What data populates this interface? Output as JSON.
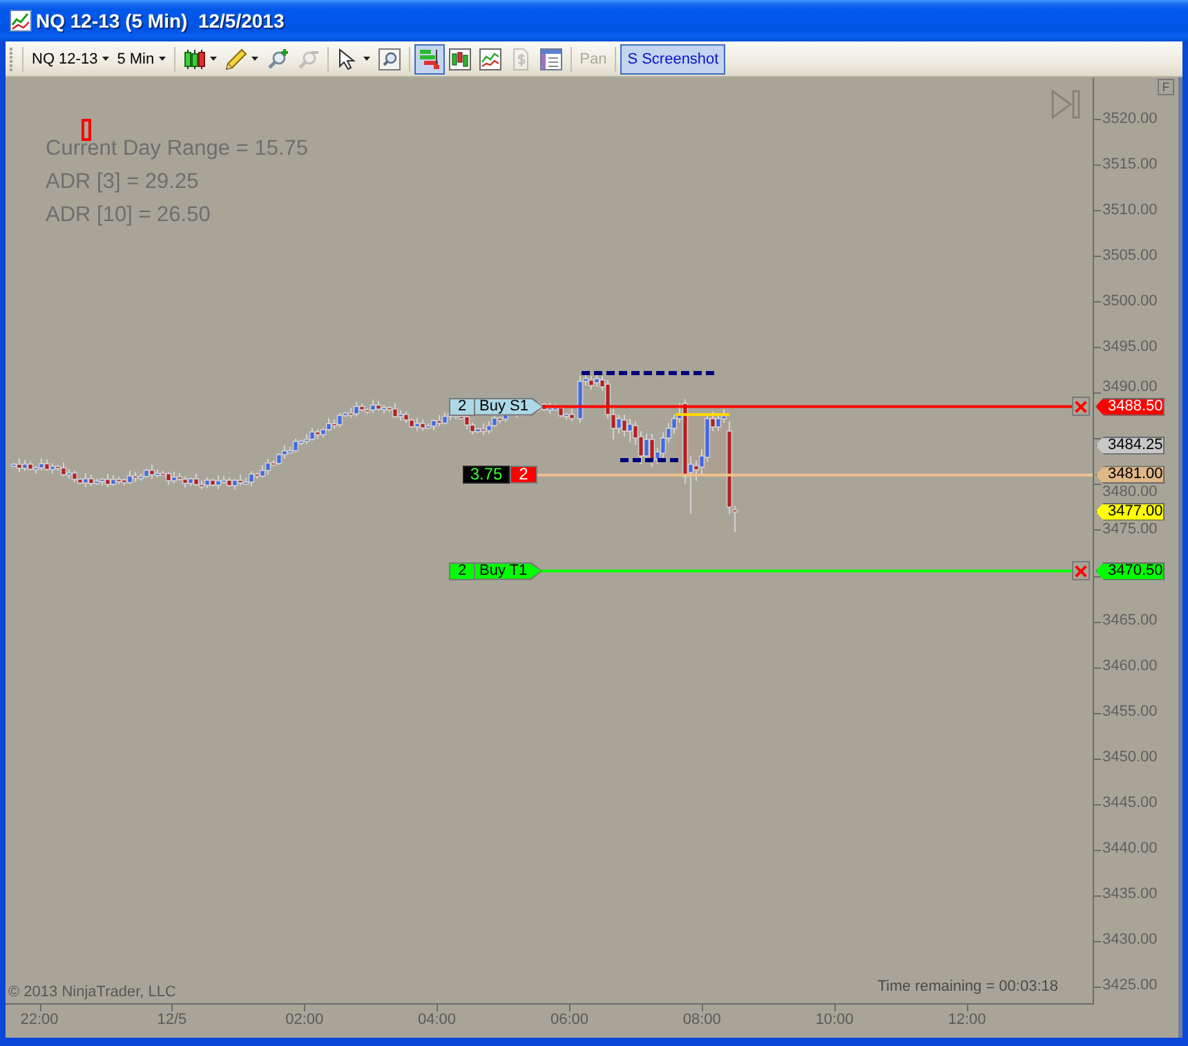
{
  "window": {
    "title": "NQ 12-13 (5 Min)  12/5/2013"
  },
  "toolbar": {
    "groups": [
      [
        {
          "kind": "dropdown",
          "label": "NQ 12-13",
          "pressed": false,
          "disabled": false
        },
        {
          "kind": "dropdown",
          "label": "5 Min",
          "pressed": false,
          "disabled": false
        }
      ],
      [
        {
          "kind": "bartype",
          "pressed": false,
          "disabled": false
        },
        {
          "kind": "pencil",
          "pressed": false,
          "disabled": false
        },
        {
          "kind": "zoomin",
          "pressed": false,
          "disabled": false
        },
        {
          "kind": "zoomout",
          "pressed": false,
          "disabled": true
        }
      ],
      [
        {
          "kind": "cursor",
          "pressed": false,
          "disabled": false
        },
        {
          "kind": "magnifier",
          "pressed": false,
          "disabled": false
        }
      ],
      [
        {
          "kind": "trader",
          "pressed": true,
          "disabled": false
        },
        {
          "kind": "candles",
          "pressed": false,
          "disabled": false
        },
        {
          "kind": "lines",
          "pressed": false,
          "disabled": false
        },
        {
          "kind": "dollar",
          "pressed": false,
          "disabled": true
        },
        {
          "kind": "databox",
          "pressed": false,
          "disabled": false
        }
      ],
      [
        {
          "kind": "pan",
          "label": "Pan",
          "pressed": false,
          "disabled": true
        }
      ],
      [
        {
          "kind": "screenshot",
          "label": "S Screenshot",
          "pressed": true,
          "disabled": false
        }
      ]
    ]
  },
  "chart": {
    "indicator_lines": [
      "Current Day Range = 15.75",
      "ADR [3] = 29.25",
      "ADR [10] = 26.50"
    ],
    "orders": [
      {
        "kind": "stop",
        "quantity": "2",
        "name": "Buy S1",
        "color": "#ff0000"
      },
      {
        "kind": "target",
        "quantity": "2",
        "name": "Buy T1",
        "color": "#00ff00"
      }
    ],
    "position": {
      "pnl": "3.75",
      "quantity": "2"
    },
    "price_axis": {
      "labels": [
        "3520.00",
        "3515.00",
        "3510.00",
        "3505.00",
        "3500.00",
        "3495.00",
        "3490.00",
        "3480.00",
        "3475.00",
        "3465.00",
        "3460.00",
        "3455.00",
        "3450.00",
        "3445.00",
        "3440.00",
        "3435.00",
        "3430.00",
        "3425.00"
      ]
    },
    "price_markers": [
      {
        "label": "3488.50",
        "color": "#ff0000"
      },
      {
        "label": "3484.25",
        "color": "#c8c8c8"
      },
      {
        "label": "3481.00",
        "color": "#deb887"
      },
      {
        "label": "3477.00",
        "color": "#ffff00"
      },
      {
        "label": "3470.50",
        "color": "#00ff00"
      }
    ],
    "time_axis": {
      "labels": [
        "22:00",
        "12/5",
        "02:00",
        "04:00",
        "06:00",
        "08:00",
        "10:00",
        "12:00"
      ]
    },
    "scale_button": "F",
    "copyright": "© 2013 NinjaTrader, LLC",
    "time_remaining": "Time remaining = 00:03:18"
  }
}
